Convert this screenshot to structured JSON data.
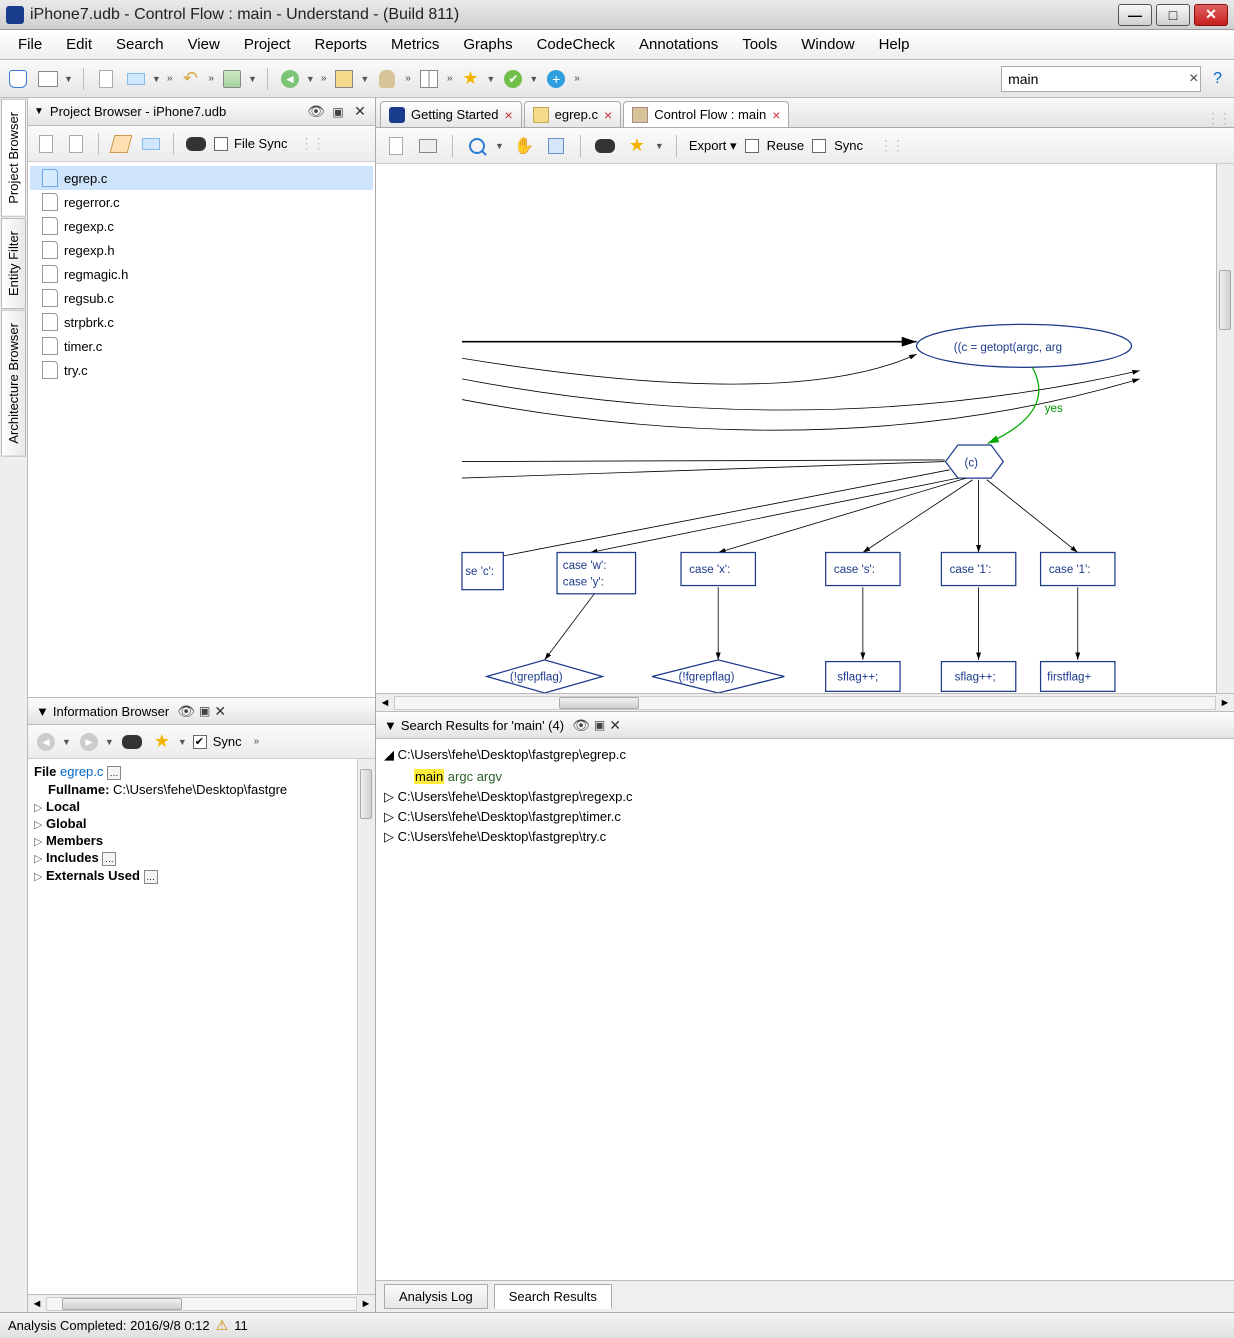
{
  "window": {
    "title": "iPhone7.udb - Control Flow : main - Understand - (Build 811)"
  },
  "menubar": [
    "File",
    "Edit",
    "Search",
    "View",
    "Project",
    "Reports",
    "Metrics",
    "Graphs",
    "CodeCheck",
    "Annotations",
    "Tools",
    "Window",
    "Help"
  ],
  "toolbar": {
    "search_value": "main"
  },
  "project_browser": {
    "title": "Project Browser - iPhone7.udb",
    "file_sync_label": "File Sync",
    "files": [
      "egrep.c",
      "regerror.c",
      "regexp.c",
      "regexp.h",
      "regmagic.h",
      "regsub.c",
      "strpbrk.c",
      "timer.c",
      "try.c"
    ]
  },
  "sidetabs": [
    "Project Browser",
    "Entity Filter",
    "Architecture Browser"
  ],
  "editor_tabs": [
    {
      "label": "Getting Started",
      "icon": "app"
    },
    {
      "label": "egrep.c",
      "icon": "cfile"
    },
    {
      "label": "Control Flow : main",
      "icon": "tree",
      "active": true
    }
  ],
  "graph_toolbar": {
    "export_label": "Export",
    "reuse_label": "Reuse",
    "sync_label": "Sync"
  },
  "flow": {
    "cond": "((c = getopt(argc, arg",
    "yes": "yes",
    "switch": "(c)",
    "cases": [
      "se 'c':",
      "case 'w':\ncase 'y':",
      "case 'x':",
      "case 's':",
      "case '1':"
    ],
    "sub": [
      "(!grepflag)",
      "(!fgrepflag)",
      "sflag++;",
      "firstflag+"
    ]
  },
  "info_browser": {
    "title": "Information Browser",
    "sync_label": "Sync",
    "file_label": "File",
    "file_name": "egrep.c",
    "fullname_label": "Fullname:",
    "fullname_value": "C:\\Users\\fehe\\Desktop\\fastgre",
    "sections": [
      "Local",
      "Global",
      "Members",
      "Includes",
      "Externals Used"
    ]
  },
  "search_results": {
    "title": "Search Results for 'main' (4)",
    "items": [
      {
        "open": true,
        "path": "C:\\Users\\fehe\\Desktop\\fastgrep\\egrep.c",
        "line_pre": "",
        "line_hl": "main",
        "line_post": " argc  argv"
      },
      {
        "open": false,
        "path": "C:\\Users\\fehe\\Desktop\\fastgrep\\regexp.c"
      },
      {
        "open": false,
        "path": "C:\\Users\\fehe\\Desktop\\fastgrep\\timer.c"
      },
      {
        "open": false,
        "path": "C:\\Users\\fehe\\Desktop\\fastgrep\\try.c"
      }
    ],
    "tabs": [
      "Analysis Log",
      "Search Results"
    ]
  },
  "statusbar": {
    "text": "Analysis Completed: 2016/9/8 0:12",
    "warn_count": "11"
  }
}
